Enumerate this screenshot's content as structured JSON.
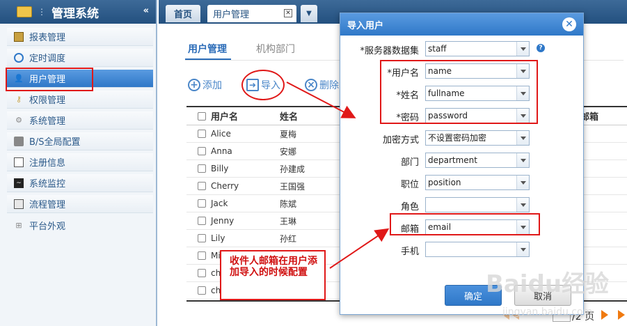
{
  "sidebar": {
    "title": "管理系统",
    "collapse": "«",
    "items": [
      {
        "label": "报表管理",
        "icon": "report-icon"
      },
      {
        "label": "定时调度",
        "icon": "clock-icon"
      },
      {
        "label": "用户管理",
        "icon": "user-icon"
      },
      {
        "label": "权限管理",
        "icon": "key-icon"
      },
      {
        "label": "系统管理",
        "icon": "gear-icon"
      },
      {
        "label": "B/S全局配置",
        "icon": "server-icon"
      },
      {
        "label": "注册信息",
        "icon": "register-icon"
      },
      {
        "label": "系统监控",
        "icon": "monitor-icon"
      },
      {
        "label": "流程管理",
        "icon": "flow-icon"
      },
      {
        "label": "平台外观",
        "icon": "appearance-icon"
      }
    ]
  },
  "tabs": {
    "home": "首页",
    "user": "用户管理"
  },
  "main": {
    "subtabs": [
      "用户管理",
      "机构部门"
    ],
    "toolbar": {
      "add": "添加",
      "import": "导入",
      "delete": "删除"
    },
    "table": {
      "headers": {
        "username": "用户名",
        "fullname": "姓名",
        "email": "邮箱"
      },
      "rows": [
        {
          "username": "Alice",
          "fullname": "夏梅"
        },
        {
          "username": "Anna",
          "fullname": "安娜"
        },
        {
          "username": "Billy",
          "fullname": "孙建成"
        },
        {
          "username": "Cherry",
          "fullname": "王国强"
        },
        {
          "username": "Jack",
          "fullname": "陈斌"
        },
        {
          "username": "Jenny",
          "fullname": "王琳"
        },
        {
          "username": "Lily",
          "fullname": "孙红"
        },
        {
          "username": "Mi",
          "fullname": ""
        },
        {
          "username": "ch",
          "fullname": ""
        },
        {
          "username": "ch",
          "fullname": ""
        }
      ]
    },
    "pager": {
      "total": "/2",
      "unit": "页"
    }
  },
  "dialog": {
    "title": "导入用户",
    "fields": [
      {
        "label": "*服务器数据集",
        "value": "staff"
      },
      {
        "label": "*用户名",
        "value": "name"
      },
      {
        "label": "*姓名",
        "value": "fullname"
      },
      {
        "label": "*密码",
        "value": "password"
      },
      {
        "label": "加密方式",
        "value": "不设置密码加密"
      },
      {
        "label": "部门",
        "value": "department"
      },
      {
        "label": "职位",
        "value": "position"
      },
      {
        "label": "角色",
        "value": ""
      },
      {
        "label": "邮箱",
        "value": "email"
      },
      {
        "label": "手机",
        "value": ""
      }
    ],
    "ok": "确定",
    "cancel": "取消"
  },
  "annotation": {
    "note": "收件人邮箱在用户添加导入的时候配置"
  },
  "watermark": {
    "text": "Baidu经验",
    "url": "jingyan.baidu.com"
  },
  "colors": {
    "accent": "#2f78c8",
    "header": "#23507f",
    "annotation": "#e01818"
  }
}
